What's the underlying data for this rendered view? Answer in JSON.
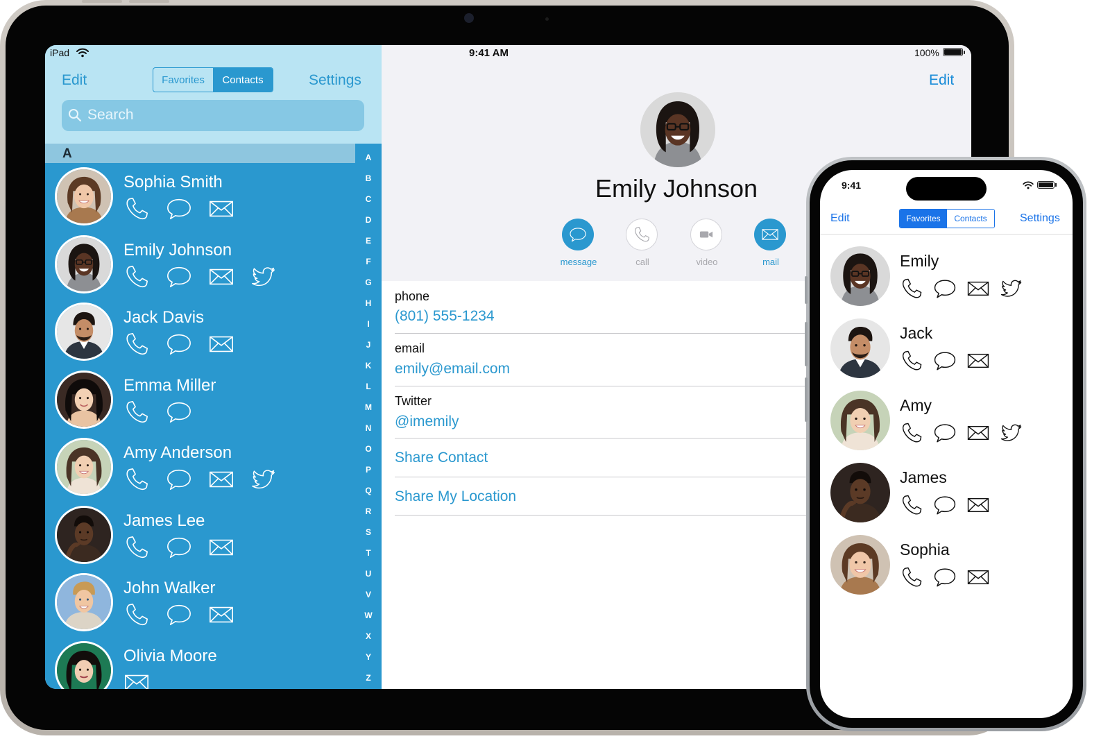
{
  "ipad": {
    "status": {
      "carrier": "iPad",
      "time": "9:41 AM",
      "battery": "100%"
    },
    "left": {
      "edit_label": "Edit",
      "settings_label": "Settings",
      "segments": [
        "Favorites",
        "Contacts"
      ],
      "selected_segment": "Contacts",
      "search_placeholder": "Search",
      "section_letter": "A",
      "contacts": [
        {
          "name": "Sophia Smith",
          "icons": [
            "phone-icon",
            "message-icon",
            "mail-icon"
          ]
        },
        {
          "name": "Emily Johnson",
          "icons": [
            "phone-icon",
            "message-icon",
            "mail-icon",
            "twitter-icon"
          ]
        },
        {
          "name": "Jack Davis",
          "icons": [
            "phone-icon",
            "message-icon",
            "mail-icon"
          ]
        },
        {
          "name": "Emma Miller",
          "icons": [
            "phone-icon",
            "message-icon"
          ]
        },
        {
          "name": "Amy Anderson",
          "icons": [
            "phone-icon",
            "message-icon",
            "mail-icon",
            "twitter-icon"
          ]
        },
        {
          "name": "James Lee",
          "icons": [
            "phone-icon",
            "message-icon",
            "mail-icon"
          ]
        },
        {
          "name": "John Walker",
          "icons": [
            "phone-icon",
            "message-icon",
            "mail-icon"
          ]
        },
        {
          "name": "Olivia Moore",
          "icons": [
            "mail-icon"
          ]
        }
      ],
      "index_letters": [
        "A",
        "B",
        "C",
        "D",
        "E",
        "F",
        "G",
        "H",
        "I",
        "J",
        "K",
        "L",
        "M",
        "N",
        "O",
        "P",
        "Q",
        "R",
        "S",
        "T",
        "U",
        "V",
        "W",
        "X",
        "Y",
        "Z"
      ]
    },
    "detail": {
      "edit_label": "Edit",
      "name": "Emily Johnson",
      "actions": [
        {
          "label": "message",
          "icon": "message-icon",
          "enabled": true
        },
        {
          "label": "call",
          "icon": "phone-icon",
          "enabled": false
        },
        {
          "label": "video",
          "icon": "video-icon",
          "enabled": false
        },
        {
          "label": "mail",
          "icon": "mail-icon",
          "enabled": true
        }
      ],
      "fields": [
        {
          "label": "phone",
          "value": "(801) 555-1234"
        },
        {
          "label": "email",
          "value": "emily@email.com"
        },
        {
          "label": "Twitter",
          "value": "@imemily"
        }
      ],
      "links": [
        "Share Contact",
        "Share My Location"
      ]
    }
  },
  "iphone": {
    "status": {
      "time": "9:41"
    },
    "nav": {
      "edit_label": "Edit",
      "settings_label": "Settings",
      "segments": [
        "Favorites",
        "Contacts"
      ],
      "selected_segment": "Favorites"
    },
    "favorites": [
      {
        "name": "Emily",
        "icons": [
          "phone-icon",
          "message-icon",
          "mail-icon",
          "twitter-icon"
        ]
      },
      {
        "name": "Jack",
        "icons": [
          "phone-icon",
          "message-icon",
          "mail-icon"
        ]
      },
      {
        "name": "Amy",
        "icons": [
          "phone-icon",
          "message-icon",
          "mail-icon",
          "twitter-icon"
        ]
      },
      {
        "name": "James",
        "icons": [
          "phone-icon",
          "message-icon",
          "mail-icon"
        ]
      },
      {
        "name": "Sophia",
        "icons": [
          "phone-icon",
          "message-icon",
          "mail-icon"
        ]
      }
    ]
  },
  "colors": {
    "accent_blue": "#2a98cf",
    "header_light_blue": "#b9e4f3",
    "iphone_accent": "#1a73e8"
  }
}
